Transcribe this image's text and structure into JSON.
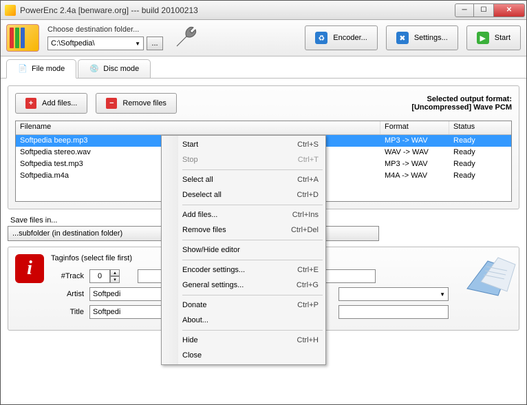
{
  "window": {
    "title": "PowerEnc 2.4a [benware.org] --- build 20100213"
  },
  "toolbar": {
    "dest_label": "Choose destination folder...",
    "dest_value": "C:\\Softpedia\\",
    "browse_label": "...",
    "encoder_label": "Encoder...",
    "settings_label": "Settings...",
    "start_label": "Start"
  },
  "tabs": {
    "file": "File mode",
    "disc": "Disc mode"
  },
  "filepanel": {
    "add_label": "Add files...",
    "remove_label": "Remove files",
    "output_line1": "Selected output format:",
    "output_line2": "[Uncompressed] Wave PCM",
    "col_filename": "Filename",
    "col_format": "Format",
    "col_status": "Status",
    "rows": [
      {
        "filename": "Softpedia beep.mp3",
        "format": "MP3 -> WAV",
        "status": "Ready"
      },
      {
        "filename": "Softpedia stereo.wav",
        "format": "WAV -> WAV",
        "status": "Ready"
      },
      {
        "filename": "Softpedia test.mp3",
        "format": "MP3 -> WAV",
        "status": "Ready"
      },
      {
        "filename": "Softpedia.m4a",
        "format": "M4A -> WAV",
        "status": "Ready"
      }
    ]
  },
  "save": {
    "legend": "Save files in...",
    "value": "...subfolder (in destination folder)"
  },
  "tags": {
    "legend": "Taginfos (select file first)",
    "track_label": "#Track",
    "track_value": "0",
    "artist_label": "Artist",
    "artist_value": "Softpedi",
    "title_label": "Title",
    "title_value": "Softpedi"
  },
  "context_menu": {
    "items": [
      {
        "label": "Start",
        "shortcut": "Ctrl+S",
        "disabled": false
      },
      {
        "label": "Stop",
        "shortcut": "Ctrl+T",
        "disabled": true
      },
      {
        "sep": true
      },
      {
        "label": "Select all",
        "shortcut": "Ctrl+A"
      },
      {
        "label": "Deselect all",
        "shortcut": "Ctrl+D"
      },
      {
        "sep": true
      },
      {
        "label": "Add files...",
        "shortcut": "Ctrl+Ins"
      },
      {
        "label": "Remove files",
        "shortcut": "Ctrl+Del"
      },
      {
        "sep": true
      },
      {
        "label": "Show/Hide editor",
        "shortcut": ""
      },
      {
        "sep": true
      },
      {
        "label": "Encoder settings...",
        "shortcut": "Ctrl+E"
      },
      {
        "label": "General settings...",
        "shortcut": "Ctrl+G"
      },
      {
        "sep": true
      },
      {
        "label": "Donate",
        "shortcut": "Ctrl+P"
      },
      {
        "label": "About...",
        "shortcut": ""
      },
      {
        "sep": true
      },
      {
        "label": "Hide",
        "shortcut": "Ctrl+H"
      },
      {
        "label": "Close",
        "shortcut": ""
      }
    ]
  }
}
